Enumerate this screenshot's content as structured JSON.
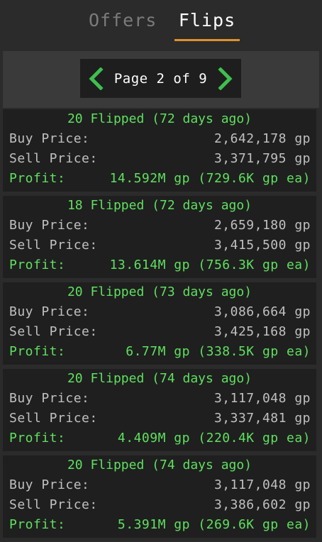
{
  "tabs": [
    {
      "label": "Offers",
      "active": false
    },
    {
      "label": "Flips",
      "active": true
    }
  ],
  "pager": {
    "label": "Page 2 of 9",
    "prev_icon": "chevron-left-icon",
    "next_icon": "chevron-right-icon"
  },
  "labels": {
    "buy": "Buy Price:",
    "sell": "Sell Price:",
    "profit": "Profit:"
  },
  "flips": [
    {
      "header": "20 Flipped (72 days ago)",
      "buy": "2,642,178 gp",
      "sell": "3,371,795 gp",
      "profit": "14.592M gp (729.6K gp ea)"
    },
    {
      "header": "18 Flipped (72 days ago)",
      "buy": "2,659,180 gp",
      "sell": "3,415,500 gp",
      "profit": "13.614M gp (756.3K gp ea)"
    },
    {
      "header": "20 Flipped (73 days ago)",
      "buy": "3,086,664 gp",
      "sell": "3,425,168 gp",
      "profit": "6.77M gp (338.5K gp ea)"
    },
    {
      "header": "20 Flipped (74 days ago)",
      "buy": "3,117,048 gp",
      "sell": "3,337,481 gp",
      "profit": "4.409M gp (220.4K gp ea)"
    },
    {
      "header": "20 Flipped (74 days ago)",
      "buy": "3,117,048 gp",
      "sell": "3,386,602 gp",
      "profit": "5.391M gp (269.6K gp ea)"
    }
  ],
  "colors": {
    "accent_tab_underline": "#e0902a",
    "profit_green": "#5fe05f",
    "arrow_green": "#3fbf4f",
    "card_bg": "#1f1f1f",
    "panel_bg": "#2b2b2b"
  }
}
